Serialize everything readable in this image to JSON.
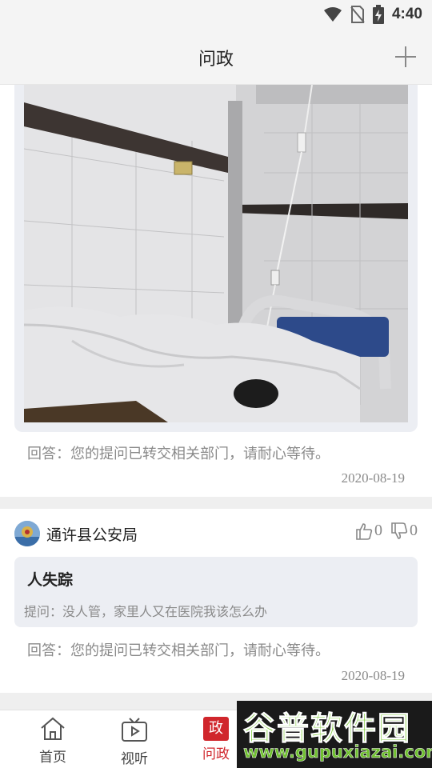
{
  "status_bar": {
    "time": "4:40"
  },
  "header": {
    "title": "问政"
  },
  "items": [
    {
      "answer": "回答：您的提问已转交相关部门，请耐心等待。",
      "date": "2020-08-19"
    },
    {
      "author": "通许县公安局",
      "likes": "0",
      "dislikes": "0",
      "question_title": "人失踪",
      "question_text": "提问：没人管，家里人又在医院我该怎么办",
      "answer": "回答：您的提问已转交相关部门，请耐心等待。",
      "date": "2020-08-19"
    }
  ],
  "bottom_nav": [
    {
      "label": "首页",
      "icon": "home-icon"
    },
    {
      "label": "视听",
      "icon": "tv-icon"
    },
    {
      "label": "问政",
      "icon": "zheng-icon",
      "icon_text": "政",
      "active": true
    }
  ],
  "watermark": {
    "title": "谷普软件园",
    "url": "www.gupuxiazai.com"
  },
  "colors": {
    "accent": "#d0262c",
    "card_bg": "#eceef3",
    "watermark_green": "#7ecb3a"
  }
}
